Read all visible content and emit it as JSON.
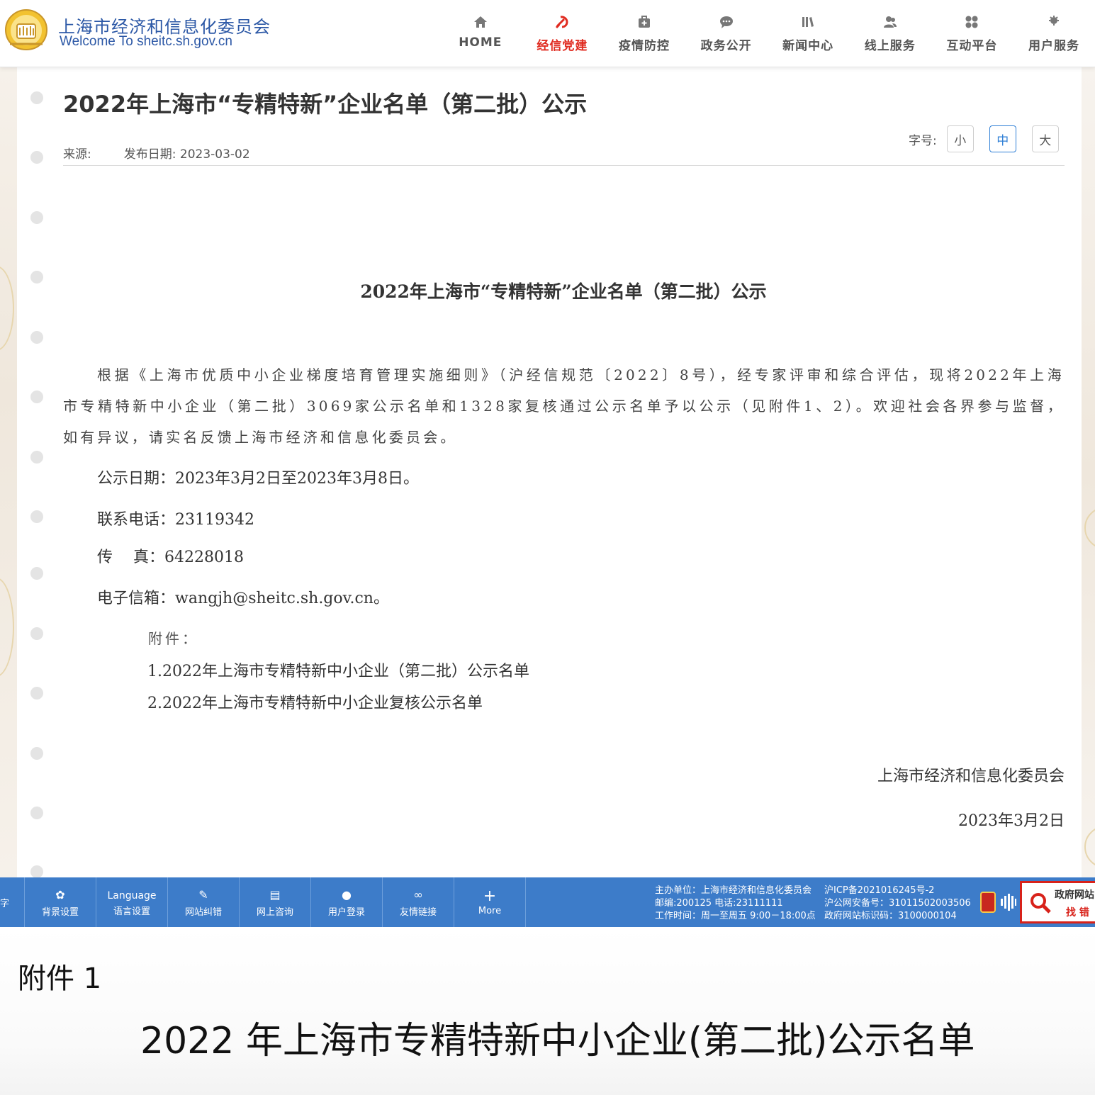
{
  "header": {
    "site_name": "上海市经济和信息化委员会",
    "site_domain": "Welcome  To  sheitc.sh.gov.cn",
    "nav": [
      {
        "label": "HOME",
        "icon": "home-icon",
        "active": false
      },
      {
        "label": "经信党建",
        "icon": "party-emblem-icon",
        "active": true
      },
      {
        "label": "疫情防控",
        "icon": "medical-kit-icon",
        "active": false
      },
      {
        "label": "政务公开",
        "icon": "chat-bubble-icon",
        "active": false
      },
      {
        "label": "新闻中心",
        "icon": "books-icon",
        "active": false
      },
      {
        "label": "线上服务",
        "icon": "users-icon",
        "active": false
      },
      {
        "label": "互动平台",
        "icon": "interaction-icon",
        "active": false
      },
      {
        "label": "用户服务",
        "icon": "user-service-icon",
        "active": false
      }
    ],
    "active_color": "#e02b20",
    "brand_color": "#2c58a6"
  },
  "article": {
    "title": "2022年上海市“专精特新”企业名单（第二批）公示",
    "source_label": "来源:",
    "date_label": "发布日期:",
    "date_value": "2023-03-02",
    "fontsize_label": "字号:",
    "fontsize_options": [
      "小",
      "中",
      "大"
    ],
    "fontsize_selected": "中"
  },
  "document": {
    "title": "2022年上海市“专精特新”企业名单（第二批）公示",
    "paragraph": "根据《上海市优质中小企业梯度培育管理实施细则》（沪经信规范〔2022〕8号），经专家评审和综合评估，现将2022年上海市专精特新中小企业（第二批）3069家公示名单和1328家复核通过公示名单予以公示（见附件1、2）。欢迎社会各界参与监督，如有异议，请实名反馈上海市经济和信息化委员会。",
    "period": "公示日期：2023年3月2日至2023年3月8日。",
    "phone": "联系电话：23119342",
    "fax": "传　 真：64228018",
    "email": "电子信箱：wangjh@sheitc.sh.gov.cn。",
    "attach_heading": "附件：",
    "attachments": [
      "1.2022年上海市专精特新中小企业（第二批）公示名单",
      "2.2022年上海市专精特新中小企业复核公示名单"
    ],
    "signature": "上海市经济和信息化委员会",
    "sign_date": "2023年3月2日"
  },
  "toolbar": {
    "cut_label": "字",
    "items": [
      {
        "icon": "✿",
        "icon_name": "settings-icon",
        "top": "",
        "label": "背景设置"
      },
      {
        "icon": "",
        "icon_name": "",
        "top": "Language",
        "label": "语言设置"
      },
      {
        "icon": "✎",
        "icon_name": "wrench-icon",
        "top": "",
        "label": "网站纠错"
      },
      {
        "icon": "▤",
        "icon_name": "message-icon",
        "top": "",
        "label": "网上咨询"
      },
      {
        "icon": "●",
        "icon_name": "user-icon",
        "top": "",
        "label": "用户登录"
      },
      {
        "icon": "∞",
        "icon_name": "link-icon",
        "top": "",
        "label": "友情链接"
      },
      {
        "icon": "+",
        "icon_name": "plus-icon",
        "top": "",
        "label": "More"
      }
    ],
    "info_left": [
      "主办单位：上海市经济和信息化委员会",
      "邮编:200125 电话:23111111",
      "工作时间：周一至周五 9:00－18:00点"
    ],
    "info_right": [
      "沪ICP备2021016245号-2",
      "沪公网安备号：31011502003506",
      "政府网站标识码：3100000104"
    ],
    "error_title": "政府网站",
    "error_sub": "找 错",
    "bar_color": "#3d7cc9"
  },
  "attachment_doc": {
    "label": "附件 1",
    "title": "2022 年上海市专精特新中小企业(第二批)公示名单"
  }
}
